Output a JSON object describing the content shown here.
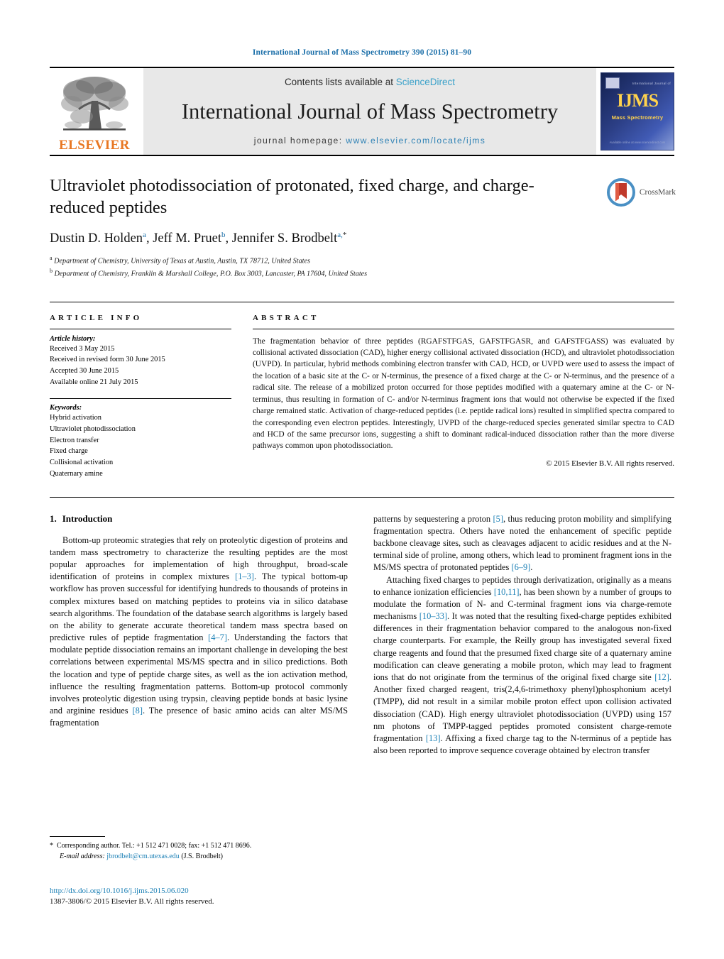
{
  "running_head": "International Journal of Mass Spectrometry 390 (2015) 81–90",
  "masthead": {
    "contents_prefix": "Contents lists available at ",
    "sciencedirect": "ScienceDirect",
    "journal_title": "International Journal of Mass Spectrometry",
    "homepage_prefix": "journal homepage: ",
    "homepage_url": "www.elsevier.com/locate/ijms",
    "publisher": "ELSEVIER",
    "publisher_logo": "elsevier-tree-icon",
    "cover": {
      "logo_text": "IJMS",
      "subtitle": "Mass Spectrometry",
      "top_caption": "International Journal of",
      "bottom_caption": "Available online at www.sciencedirect.com"
    },
    "colors": {
      "link": "#3aa1c9",
      "elsevier_orange": "#E87722",
      "masthead_bg": "#e8e8e8",
      "cover_dark": "#12204f",
      "cover_accent": "#ffd34d"
    }
  },
  "article": {
    "title": "Ultraviolet photodissociation of protonated, fixed charge, and charge-reduced peptides",
    "authors": [
      {
        "name": "Dustin D. Holden",
        "marks": "a",
        "sep": ", "
      },
      {
        "name": "Jeff M. Pruet",
        "marks": "b",
        "sep": ", "
      },
      {
        "name": "Jennifer S. Brodbelt",
        "marks": "a,",
        "star": "*",
        "sep": ""
      }
    ],
    "affiliations": [
      {
        "mark": "a",
        "text": "Department of Chemistry, University of Texas at Austin, Austin, TX 78712, United States"
      },
      {
        "mark": "b",
        "text": "Department of Chemistry, Franklin & Marshall College, P.O. Box 3003, Lancaster, PA 17604, United States"
      }
    ],
    "crossmark_label": "CrossMark",
    "crossmark_icon": "crossmark-icon"
  },
  "article_info": {
    "heading": "ARTICLE INFO",
    "history_label": "Article history:",
    "history": [
      "Received 3 May 2015",
      "Received in revised form 30 June 2015",
      "Accepted 30 June 2015",
      "Available online 21 July 2015"
    ],
    "keywords_label": "Keywords:",
    "keywords": [
      "Hybrid activation",
      "Ultraviolet photodissociation",
      "Electron transfer",
      "Fixed charge",
      "Collisional activation",
      "Quaternary amine"
    ]
  },
  "abstract": {
    "heading": "ABSTRACT",
    "text": "The fragmentation behavior of three peptides (RGAFSTFGAS, GAFSTFGASR, and GAFSTFGASS) was evaluated by collisional activated dissociation (CAD), higher energy collisional activated dissociation (HCD), and ultraviolet photodissociation (UVPD). In particular, hybrid methods combining electron transfer with CAD, HCD, or UVPD were used to assess the impact of the location of a basic site at the C- or N-terminus, the presence of a fixed charge at the C- or N-terminus, and the presence of a radical site. The release of a mobilized proton occurred for those peptides modified with a quaternary amine at the C- or N-terminus, thus resulting in formation of C- and/or N-terminus fragment ions that would not otherwise be expected if the fixed charge remained static. Activation of charge-reduced peptides (i.e. peptide radical ions) resulted in simplified spectra compared to the corresponding even electron peptides. Interestingly, UVPD of the charge-reduced species generated similar spectra to CAD and HCD of the same precursor ions, suggesting a shift to dominant radical-induced dissociation rather than the more diverse pathways common upon photodissociation.",
    "copyright": "© 2015 Elsevier B.V. All rights reserved."
  },
  "body": {
    "section_number": "1.",
    "section_title": "Introduction",
    "left_paragraph_1": "Bottom-up proteomic strategies that rely on proteolytic digestion of proteins and tandem mass spectrometry to characterize the resulting peptides are the most popular approaches for implementation of high throughput, broad-scale identification of proteins in complex mixtures [1–3]. The typical bottom-up workflow has proven successful for identifying hundreds to thousands of proteins in complex mixtures based on matching peptides to proteins via in silico database search algorithms. The foundation of the database search algorithms is largely based on the ability to generate accurate theoretical tandem mass spectra based on predictive rules of peptide fragmentation [4–7]. Understanding the factors that modulate peptide dissociation remains an important challenge in developing the best correlations between experimental MS/MS spectra and in silico predictions. Both the location and type of peptide charge sites, as well as the ion activation method, influence the resulting fragmentation patterns. Bottom-up protocol commonly involves proteolytic digestion using trypsin, cleaving peptide bonds at basic lysine and arginine residues [8]. The presence of basic amino acids can alter MS/MS fragmentation",
    "right_paragraph_1": "patterns by sequestering a proton [5], thus reducing proton mobility and simplifying fragmentation spectra. Others have noted the enhancement of specific peptide backbone cleavage sites, such as cleavages adjacent to acidic residues and at the N-terminal side of proline, among others, which lead to prominent fragment ions in the MS/MS spectra of protonated peptides [6–9].",
    "right_paragraph_2": "Attaching fixed charges to peptides through derivatization, originally as a means to enhance ionization efficiencies [10,11], has been shown by a number of groups to modulate the formation of N- and C-terminal fragment ions via charge-remote mechanisms [10–33]. It was noted that the resulting fixed-charge peptides exhibited differences in their fragmentation behavior compared to the analogous non-fixed charge counterparts. For example, the Reilly group has investigated several fixed charge reagents and found that the presumed fixed charge site of a quaternary amine modification can cleave generating a mobile proton, which may lead to fragment ions that do not originate from the terminus of the original fixed charge site [12]. Another fixed charged reagent, tris(2,4,6-trimethoxy phenyl)phosphonium acetyl (TMPP), did not result in a similar mobile proton effect upon collision activated dissociation (CAD). High energy ultraviolet photodissociation (UVPD) using 157 nm photons of TMPP-tagged peptides promoted consistent charge-remote fragmentation [13]. Affixing a fixed charge tag to the N-terminus of a peptide has also been reported to improve sequence coverage obtained by electron transfer"
  },
  "footnote": {
    "star": "*",
    "corresponding": "Corresponding author. Tel.: +1 512 471 0028; fax: +1 512 471 8696.",
    "email_label": "E-mail address:",
    "email": "jbrodbelt@cm.utexas.edu",
    "email_owner": "(J.S. Brodbelt)"
  },
  "footer": {
    "doi": "http://dx.doi.org/10.1016/j.ijms.2015.06.020",
    "issn_line": "1387-3806/© 2015 Elsevier B.V. All rights reserved."
  }
}
